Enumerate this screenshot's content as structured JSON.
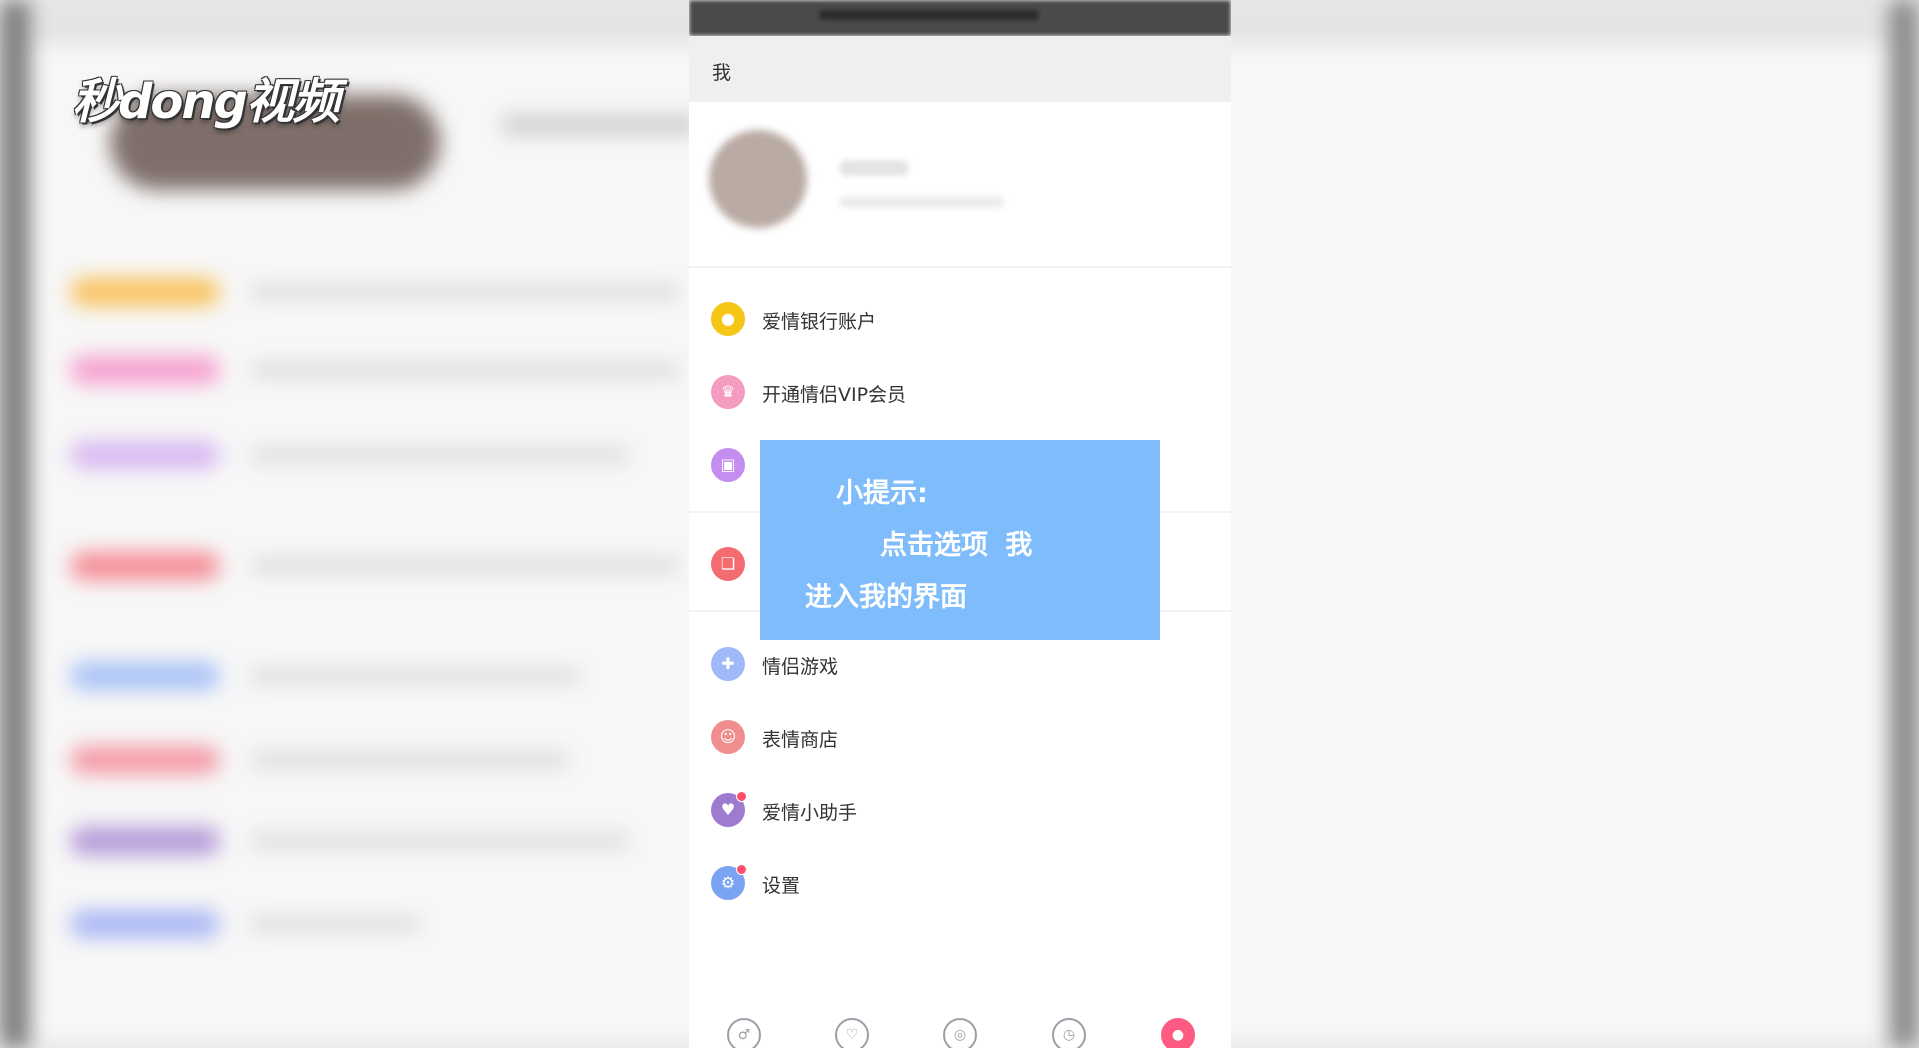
{
  "watermark": {
    "logo_text": "秒dong视频"
  },
  "header": {
    "title": "我"
  },
  "menu": {
    "items": [
      {
        "label": "爱情银行账户",
        "icon": "coin-icon",
        "color": "#f5c518",
        "badge": false
      },
      {
        "label": "开通情侣VIP会员",
        "icon": "crown-icon",
        "color": "#f59bc0",
        "badge": false
      },
      {
        "label": "",
        "icon": "photo-card-icon",
        "color": "#c48ef0",
        "badge": false
      },
      {
        "label": "",
        "icon": "gift-icon",
        "color": "#f46b70",
        "badge": false
      },
      {
        "label": "情侣游戏",
        "icon": "gamepad-icon",
        "color": "#9eb8f8",
        "badge": false
      },
      {
        "label": "表情商店",
        "icon": "emoji-icon",
        "color": "#f08e8e",
        "badge": false
      },
      {
        "label": "爱情小助手",
        "icon": "heart-assistant-icon",
        "color": "#9c7bd0",
        "badge": true
      },
      {
        "label": "设置",
        "icon": "gear-icon",
        "color": "#7aa4f2",
        "badge": true
      }
    ]
  },
  "tip": {
    "line1": "小提示:",
    "line2": "点击选项 我",
    "line3": "进入我的界面"
  },
  "tabbar": {
    "tabs": [
      {
        "icon": "couple-icon",
        "active": false
      },
      {
        "icon": "heart-chat-icon",
        "active": false
      },
      {
        "icon": "discover-icon",
        "active": false
      },
      {
        "icon": "clock-icon",
        "active": false
      },
      {
        "icon": "me-icon",
        "active": true
      }
    ]
  },
  "colors": {
    "tip_bg": "#7fbcfb",
    "accent": "#ff5a82"
  }
}
